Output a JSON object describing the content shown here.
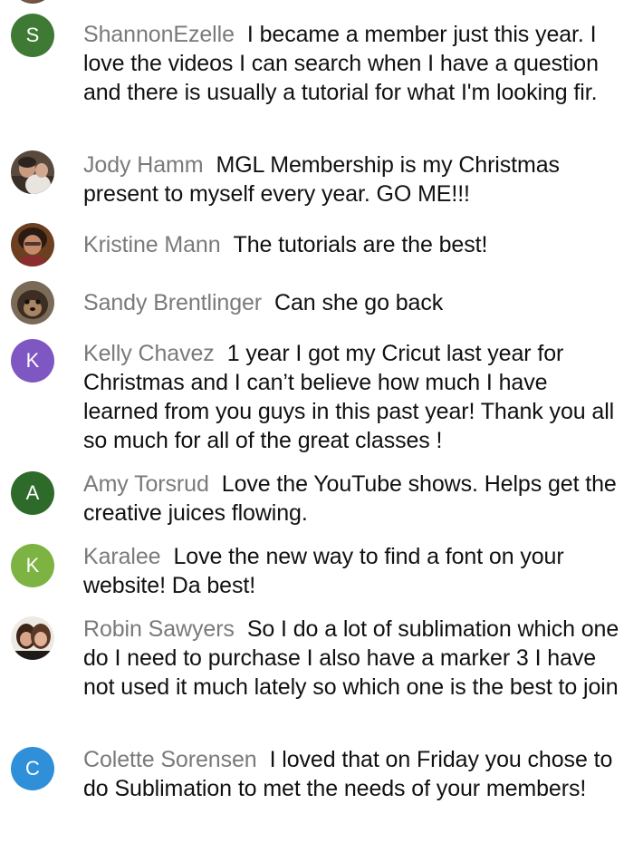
{
  "messages": [
    {
      "author": "ShannonEzelle",
      "text": "I became a member just this year. I love the videos I can search when I have a question and there is usually a tutorial for what I'm looking fir.",
      "avatar_letter": "S",
      "avatar_color": "#3f7a34"
    },
    {
      "author": "Jody Hamm",
      "text": "MGL Membership is my Christmas present to myself every year. GO ME!!!",
      "avatar_letter": "",
      "avatar_color": ""
    },
    {
      "author": "Kristine Mann",
      "text": "The tutorials are the best!",
      "avatar_letter": "",
      "avatar_color": ""
    },
    {
      "author": "Sandy Brentlinger",
      "text": "Can she go back",
      "avatar_letter": "",
      "avatar_color": ""
    },
    {
      "author": "Kelly Chavez",
      "text": "1 year I got my Cricut last year for Christmas and I can’t believe how much I have learned from you guys in this past year! Thank you all so much for all of the great classes !",
      "avatar_letter": "K",
      "avatar_color": "#7e57c2"
    },
    {
      "author": "Amy Torsrud",
      "text": "Love the YouTube shows. Helps get the creative juices flowing.",
      "avatar_letter": "A",
      "avatar_color": "#2e6b2a"
    },
    {
      "author": "Karalee",
      "text": "Love the new way to find a font on your website! Da best!",
      "avatar_letter": "K",
      "avatar_color": "#7cb342"
    },
    {
      "author": "Robin Sawyers",
      "text": "So I do a lot of sublimation which one do I need to purchase I also have a marker 3 I have not used it much lately so which one is the best to join",
      "avatar_letter": "",
      "avatar_color": ""
    },
    {
      "author": "Colette Sorensen",
      "text": "I loved that on Friday you chose to do Sublimation to met the needs of your members!",
      "avatar_letter": "C",
      "avatar_color": "#2f8fd8"
    }
  ]
}
